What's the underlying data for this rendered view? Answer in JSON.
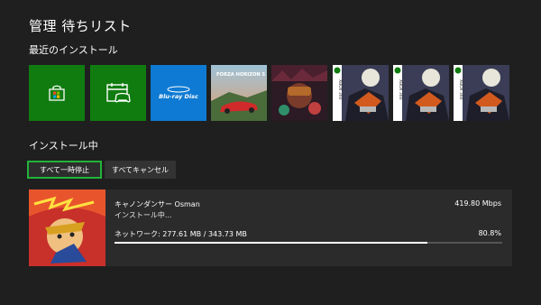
{
  "page": {
    "title": "管理 待ちリスト"
  },
  "recent": {
    "heading": "最近のインストール",
    "tiles": [
      {
        "name": "store-tile",
        "icon": "store-bag-icon",
        "color": "#107c10"
      },
      {
        "name": "xbox-app-tile",
        "icon": "calendar-controller-icon",
        "color": "#107c10"
      },
      {
        "name": "bluray-tile",
        "label": "Blu-ray Disc",
        "color": "#0e7ad3"
      },
      {
        "name": "forza-tile",
        "label": "FORZA HORIZON 5"
      },
      {
        "name": "game-tile"
      },
      {
        "name": "xbox360-game-tile",
        "badge": "XBOX 360"
      },
      {
        "name": "xbox360-game-tile",
        "badge": "XBOX 360"
      },
      {
        "name": "xbox360-game-tile",
        "badge": "XBOX 360"
      }
    ]
  },
  "installing": {
    "heading": "インストール中",
    "pause_all": "すべて一時停止",
    "cancel_all": "すべてキャンセル"
  },
  "download": {
    "name": "キャノンダンサー Osman",
    "status": "インストール中...",
    "speed": "419.80 Mbps",
    "network": "ネットワーク: 277.61 MB / 343.73 MB",
    "percent_text": "80.8%",
    "progress": 0.808
  },
  "colors": {
    "accent_green": "#21b43a",
    "background": "#1f1f1f"
  }
}
